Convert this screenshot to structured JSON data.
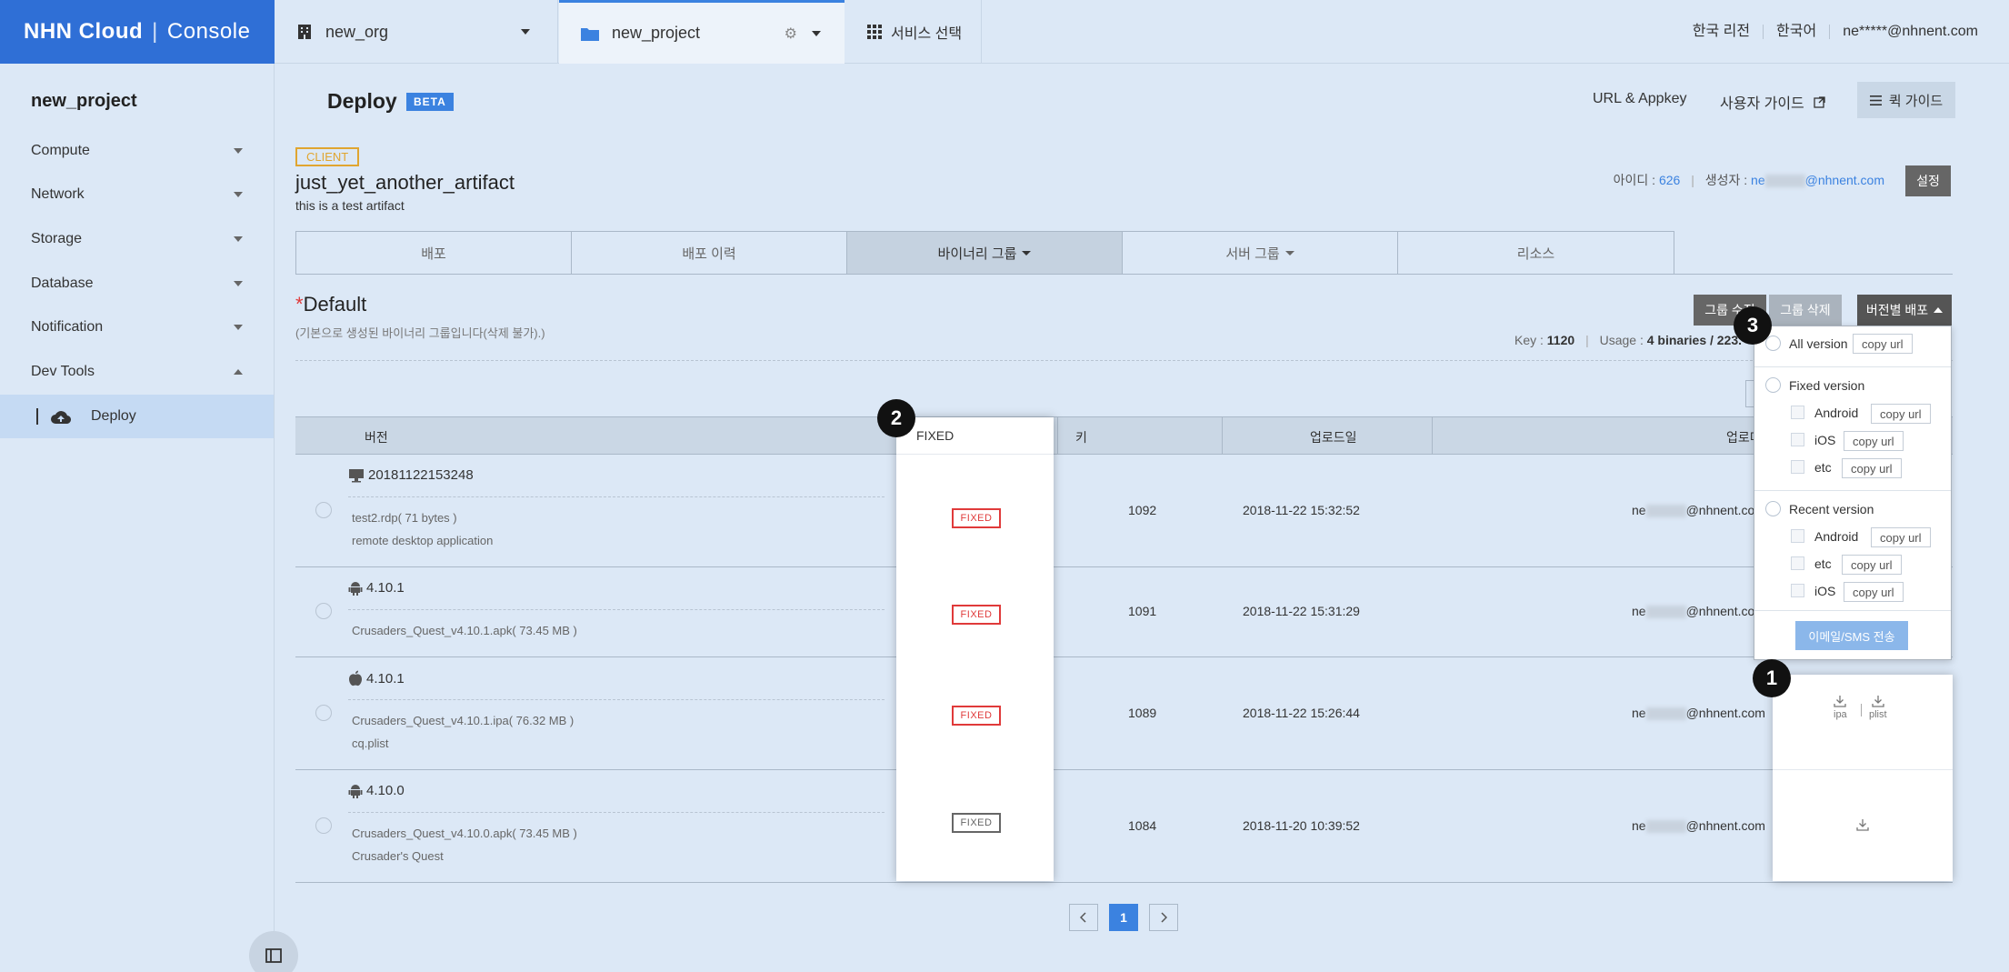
{
  "header": {
    "logo_brand": "NHN Cloud",
    "logo_console": "Console",
    "org": "new_org",
    "project": "new_project",
    "service_select": "서비스 선택",
    "region": "한국 리전",
    "language": "한국어",
    "user_email": "ne*****@nhnent.com"
  },
  "sidebar": {
    "project": "new_project",
    "items": [
      {
        "label": "Compute"
      },
      {
        "label": "Network"
      },
      {
        "label": "Storage"
      },
      {
        "label": "Database"
      },
      {
        "label": "Notification"
      },
      {
        "label": "Dev Tools"
      }
    ],
    "sub_item": "Deploy"
  },
  "page": {
    "title": "Deploy",
    "beta": "BETA",
    "url_appkey": "URL & Appkey",
    "user_guide": "사용자 가이드",
    "quick_guide": "퀵 가이드"
  },
  "artifact": {
    "badge": "CLIENT",
    "name": "just_yet_another_artifact",
    "desc": "this is a test artifact",
    "id_label": "아이디 :",
    "id": "626",
    "creator_label": "생성자 :",
    "creator_prefix": "ne",
    "creator_suffix": "@nhnent.com",
    "settings": "설정"
  },
  "tabs": [
    "배포",
    "배포 이력",
    "바이너리 그룹",
    "서버 그룹",
    "리소스"
  ],
  "group": {
    "required_mark": "*",
    "title": "Default",
    "desc": "(기본으로 생성된 바이너리 그룹입니다(삭제 불가).)",
    "key_label": "Key :",
    "key": "1120",
    "usage_label": "Usage :",
    "usage": "4 binaries / 223.",
    "edit": "그룹 수정",
    "delete": "그룹 삭제",
    "version_deploy": "버전별 배포"
  },
  "table": {
    "headers": {
      "version": "버전",
      "fixed": "FIXED",
      "key": "키",
      "upload_date": "업로드일",
      "uploader": "업로더"
    },
    "rows": [
      {
        "version": "20181122153248",
        "icon": "desktop-icon",
        "file": "test2.rdp( 71 bytes )",
        "note": "remote desktop application",
        "fixed": "FIXED",
        "fixed_state": "on",
        "key": "1092",
        "date": "2018-11-22 15:32:52",
        "uploader_prefix": "ne",
        "uploader_suffix": "@nhnent.com"
      },
      {
        "version": "4.10.1",
        "icon": "android-icon",
        "file": "Crusaders_Quest_v4.10.1.apk( 73.45 MB )",
        "note": "",
        "fixed": "FIXED",
        "fixed_state": "on",
        "key": "1091",
        "date": "2018-11-22 15:31:29",
        "uploader_prefix": "ne",
        "uploader_suffix": "@nhnent.com"
      },
      {
        "version": "4.10.1",
        "icon": "apple-icon",
        "file": "Crusaders_Quest_v4.10.1.ipa( 76.32 MB )",
        "note": "cq.plist",
        "fixed": "FIXED",
        "fixed_state": "on",
        "key": "1089",
        "date": "2018-11-22 15:26:44",
        "uploader_prefix": "ne",
        "uploader_suffix": "@nhnent.com"
      },
      {
        "version": "4.10.0",
        "icon": "android-icon",
        "file": "Crusaders_Quest_v4.10.0.apk( 73.45 MB )",
        "note": "Crusader's Quest",
        "fixed": "FIXED",
        "fixed_state": "off",
        "key": "1084",
        "date": "2018-11-20 10:39:52",
        "uploader_prefix": "ne",
        "uploader_suffix": "@nhnent.com"
      }
    ]
  },
  "download": {
    "ipa": "ipa",
    "plist": "plist"
  },
  "dropdown": {
    "all_version": "All version",
    "fixed_version": "Fixed version",
    "recent_version": "Recent version",
    "android": "Android",
    "ios": "iOS",
    "etc": "etc",
    "copy_url": "copy url",
    "send": "이메일/SMS 전송"
  },
  "callouts": [
    "1",
    "2",
    "3"
  ],
  "pagination": {
    "current": "1"
  },
  "colors": {
    "brand": "#2f6fd6",
    "accent": "#3b82e0",
    "fixed_red": "#e03a3a",
    "client_orange": "#e0a530"
  }
}
